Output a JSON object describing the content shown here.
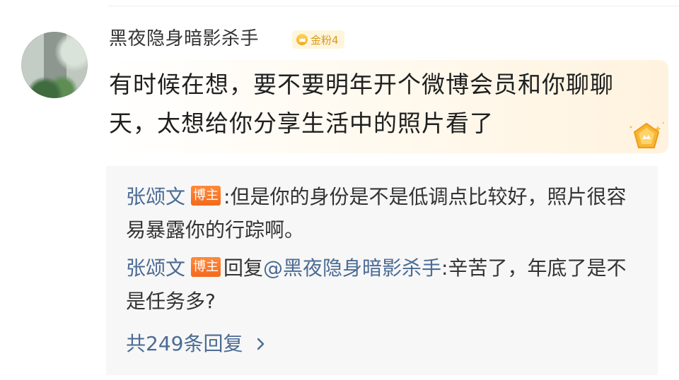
{
  "comment": {
    "username": "黑夜隐身暗影杀手",
    "fan_badge": {
      "label": "金粉4",
      "icon": "crown-icon",
      "color": "#d89b1b"
    },
    "text": "有时候在想，要不要明年开个微博会员和你聊聊天，太想给你分享生活中的照片看了",
    "member_icon": "vip-crown-icon"
  },
  "replies": [
    {
      "author": "张颂文",
      "badge": "博主",
      "separator": ":",
      "text": "但是你的身份是不是低调点比较好，照片很容易暴露你的行踪啊。"
    },
    {
      "author": "张颂文",
      "badge": "博主",
      "prefix": "回复",
      "mention": "@黑夜隐身暗影杀手",
      "text": ":辛苦了，年底了是不是任务多?"
    }
  ],
  "more_replies": {
    "label": "共249条回复",
    "icon": "chevron-right-icon"
  },
  "colors": {
    "link": "#4a6b94",
    "badge_orange": "#f36a1c",
    "reply_bg": "#f7f7f7"
  }
}
